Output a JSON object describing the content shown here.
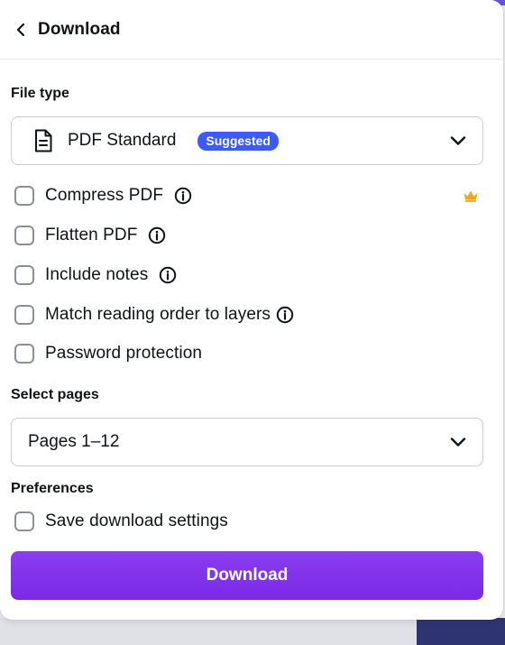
{
  "header": {
    "title": "Download",
    "back_icon": "chevron-left-icon"
  },
  "file_type": {
    "label": "File type",
    "selected": "PDF Standard",
    "badge": "Suggested",
    "icon": "document-icon"
  },
  "pdf_options": [
    {
      "label": "Compress PDF",
      "checked": false,
      "info": true,
      "premium": true
    },
    {
      "label": "Flatten PDF",
      "checked": false,
      "info": true
    },
    {
      "label": "Include notes",
      "checked": false,
      "info": true
    },
    {
      "label": "Match reading order to layers",
      "checked": false,
      "info": true
    },
    {
      "label": "Password protection",
      "checked": false,
      "info": false
    }
  ],
  "select_pages": {
    "label": "Select pages",
    "selected": "Pages 1–12"
  },
  "preferences": {
    "label": "Preferences",
    "save_settings": {
      "label": "Save download settings",
      "checked": false
    }
  },
  "download_button": {
    "label": "Download"
  },
  "colors": {
    "accent": "#7d2ae8",
    "badge": "#3d5afe",
    "crown": "#f5a524",
    "text": "#0e1318"
  }
}
